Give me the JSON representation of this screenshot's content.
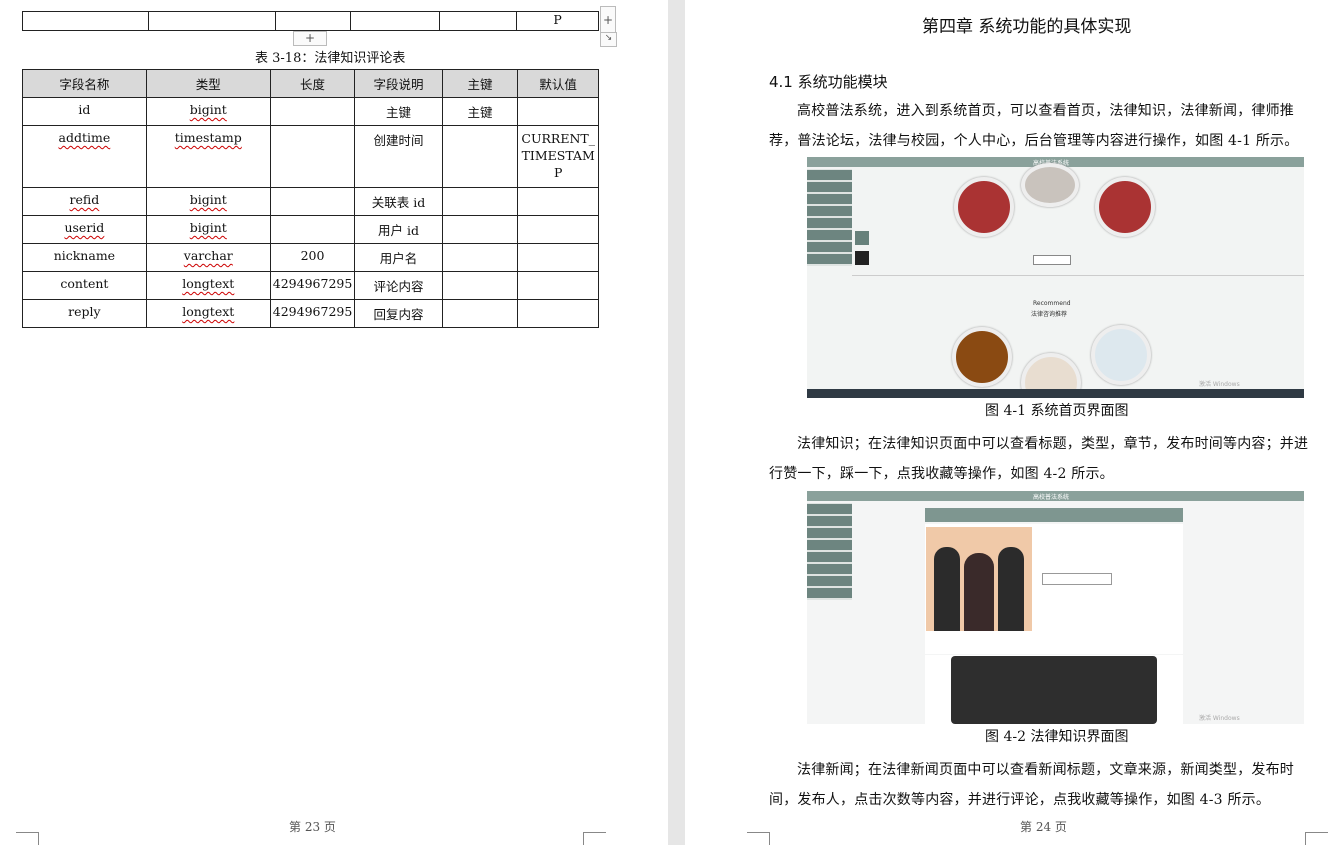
{
  "page23": {
    "prev_row_last": "P",
    "caption": "表 3-18：法律知识评论表",
    "headers": [
      "字段名称",
      "类型",
      "长度",
      "字段说明",
      "主键",
      "默认值"
    ],
    "rows": [
      [
        "id",
        "bigint",
        "",
        "主键",
        "主键",
        ""
      ],
      [
        "addtime",
        "timestamp",
        "",
        "创建时间",
        "",
        "CURRENT_TIMESTAMP"
      ],
      [
        "refid",
        "bigint",
        "",
        "关联表 id",
        "",
        ""
      ],
      [
        "userid",
        "bigint",
        "",
        "用户 id",
        "",
        ""
      ],
      [
        "nickname",
        "varchar",
        "200",
        "用户名",
        "",
        ""
      ],
      [
        "content",
        "longtext",
        "4294967295",
        "评论内容",
        "",
        ""
      ],
      [
        "reply",
        "longtext",
        "4294967295",
        "回复内容",
        "",
        ""
      ]
    ],
    "footer": "第 23 页",
    "add_row_label": "+",
    "add_col_label": "+"
  },
  "page24": {
    "chapter_title": "第四章 系统功能的具体实现",
    "section_title": "4.1 系统功能模块",
    "para1": "高校普法系统，进入到系统首页，可以查看首页，法律知识，法律新闻，律师推荐，普法论坛，法律与校园，个人中心，后台管理等内容进行操作，如图 4-1 所示。",
    "fig1_caption": "图 4-1 系统首页界面图",
    "fig1_header": "高校普法系统",
    "fig1_recommend": "Recommend",
    "fig1_recommend_cn": "法律咨询推荐",
    "fig1_watermark": "激活 Windows",
    "para2": "法律知识；在法律知识页面中可以查看标题，类型，章节，发布时间等内容；并进行赞一下，踩一下，点我收藏等操作，如图 4-2 所示。",
    "fig2_caption": "图 4-2 法律知识界面图",
    "fig2_header": "高校普法系统",
    "fig2_watermark": "激活 Windows",
    "para3": "法律新闻；在法律新闻页面中可以查看新闻标题，文章来源，新闻类型，发布时间，发布人，点击次数等内容，并进行评论，点我收藏等操作，如图 4-3 所示。",
    "footer": "第 24 页"
  }
}
